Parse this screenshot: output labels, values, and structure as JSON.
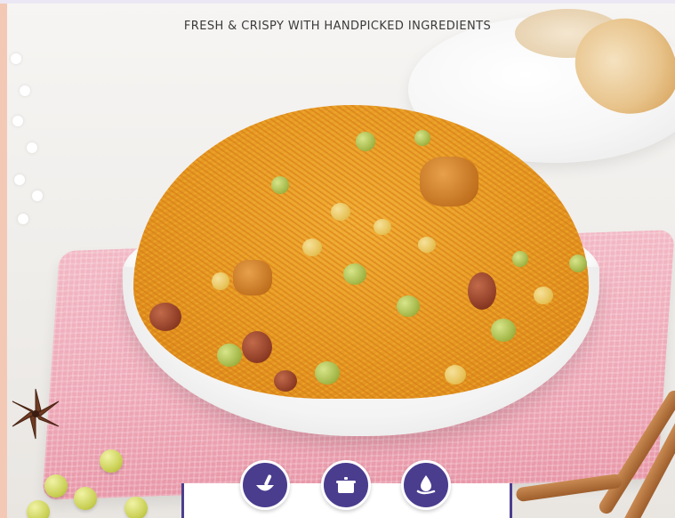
{
  "tagline": "FRESH & CRISPY WITH HANDPICKED INGREDIENTS",
  "side_text": "",
  "panel_text": "",
  "icons": [
    "mortar-pestle-icon",
    "cooking-pot-icon",
    "hand-drop-icon"
  ],
  "colors": {
    "accent": "#4a3d8e",
    "towel": "#eea8b7",
    "namkeen": "#e59a25"
  }
}
